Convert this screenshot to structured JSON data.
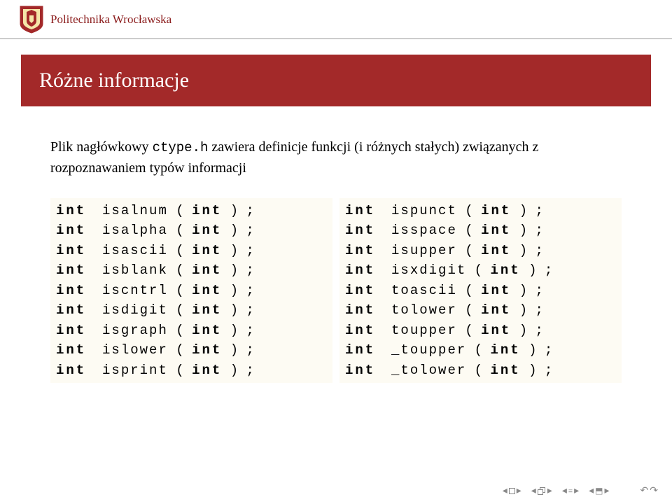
{
  "brand": "Politechnika Wrocławska",
  "title": "Różne informacje",
  "intro_pre": "Plik nagłówkowy ",
  "intro_code": "ctype.h",
  "intro_post": " zawiera definicje funkcji (i różnych stałych) związanych z rozpoznawaniem typów informacji",
  "kw": "int",
  "left": [
    "isalnum",
    "isalpha",
    "isascii",
    "isblank",
    "iscntrl",
    "isdigit",
    "isgraph",
    "islower",
    "isprint"
  ],
  "right": [
    "ispunct",
    "isspace",
    "isupper",
    "isxdigit",
    "toascii",
    "tolower",
    "toupper",
    "_toupper",
    "_tolower"
  ]
}
